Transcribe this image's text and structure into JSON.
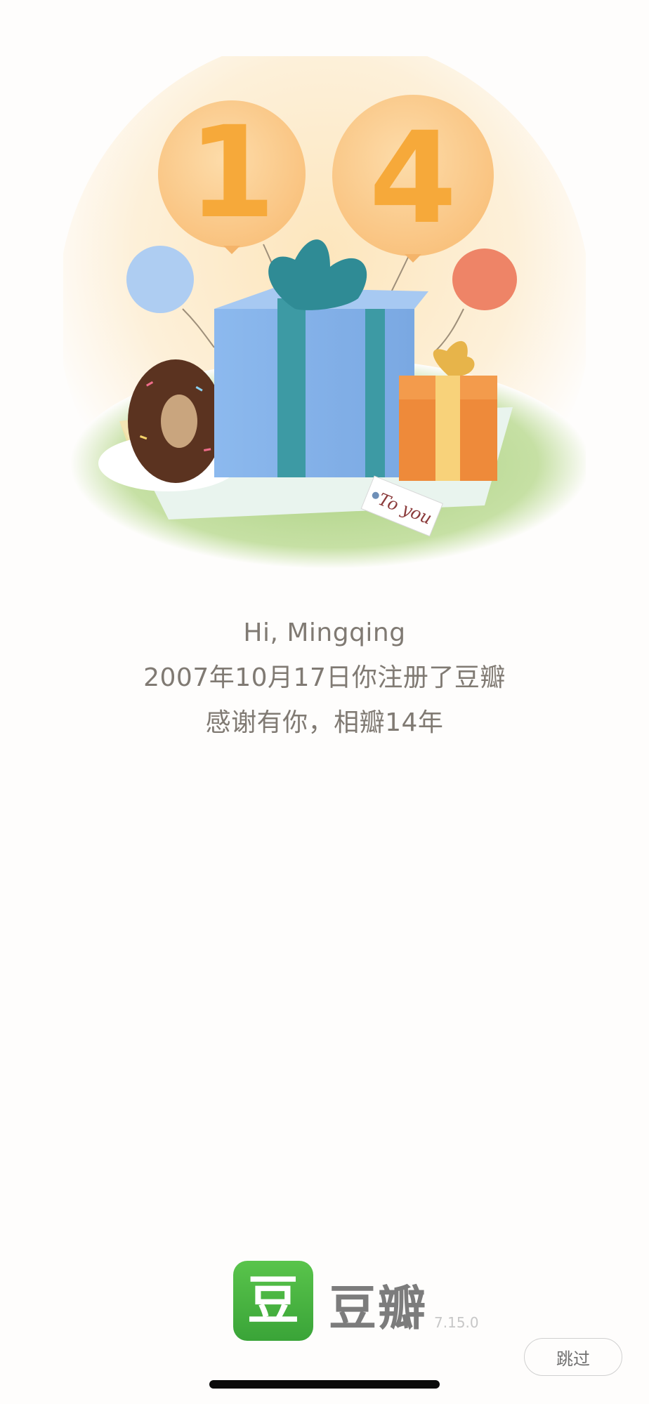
{
  "illustration": {
    "balloon_digit_1": "1",
    "balloon_digit_2": "4",
    "tag_text": "To you"
  },
  "greeting": {
    "line1": "Hi, Mingqing",
    "line2": "2007年10月17日你注册了豆瓣",
    "line3": "感谢有你，相瓣14年"
  },
  "brand": {
    "logo_char": "豆",
    "name": "豆瓣",
    "version": "7.15.0"
  },
  "skip_button": {
    "label": "跳过"
  },
  "colors": {
    "background": "#fefdfc",
    "text": "#807a73",
    "brand_green": "#4cb543"
  }
}
